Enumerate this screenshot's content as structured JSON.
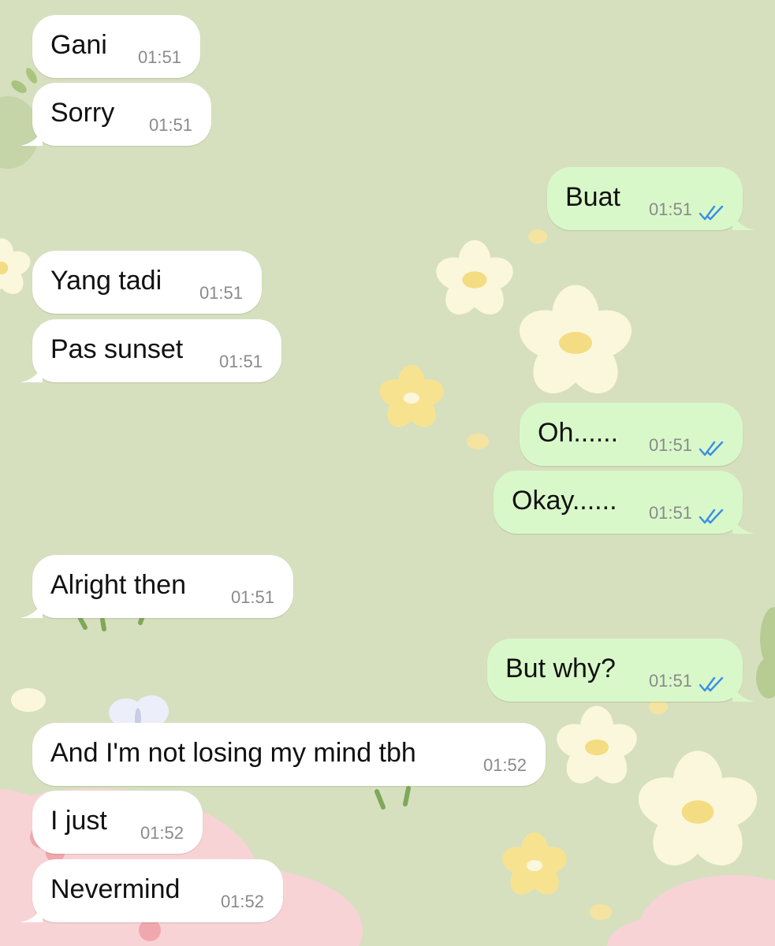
{
  "chat": {
    "messages": [
      {
        "dir": "in",
        "text": "Gani",
        "time": "01:51"
      },
      {
        "dir": "in",
        "text": "Sorry",
        "time": "01:51"
      },
      {
        "dir": "out",
        "text": "Buat",
        "time": "01:51",
        "status": "read"
      },
      {
        "dir": "in",
        "text": "Yang tadi",
        "time": "01:51"
      },
      {
        "dir": "in",
        "text": "Pas sunset",
        "time": "01:51"
      },
      {
        "dir": "out",
        "text": "Oh......",
        "time": "01:51",
        "status": "read"
      },
      {
        "dir": "out",
        "text": "Okay......",
        "time": "01:51",
        "status": "read"
      },
      {
        "dir": "in",
        "text": "Alright then",
        "time": "01:51"
      },
      {
        "dir": "out",
        "text": "But why?",
        "time": "01:51",
        "status": "read"
      },
      {
        "dir": "in",
        "text": "And I'm not losing my mind tbh",
        "time": "01:52"
      },
      {
        "dir": "in",
        "text": "I just",
        "time": "01:52"
      },
      {
        "dir": "in",
        "text": "Nevermind",
        "time": "01:52"
      }
    ]
  },
  "colors": {
    "wallpaper": "#d6e0bf",
    "incoming_bubble": "#ffffff",
    "outgoing_bubble": "#d9f8c9",
    "read_ticks": "#3a8ee6",
    "timestamp": "#8a8a8a",
    "flower_petal": "#fbf7dc",
    "flower_center": "#f3dc82",
    "pink_cloud": "#f7d3d6"
  },
  "icons": {
    "read_receipt": "double-check-icon",
    "wallpaper_decoration": "flower-icon"
  }
}
